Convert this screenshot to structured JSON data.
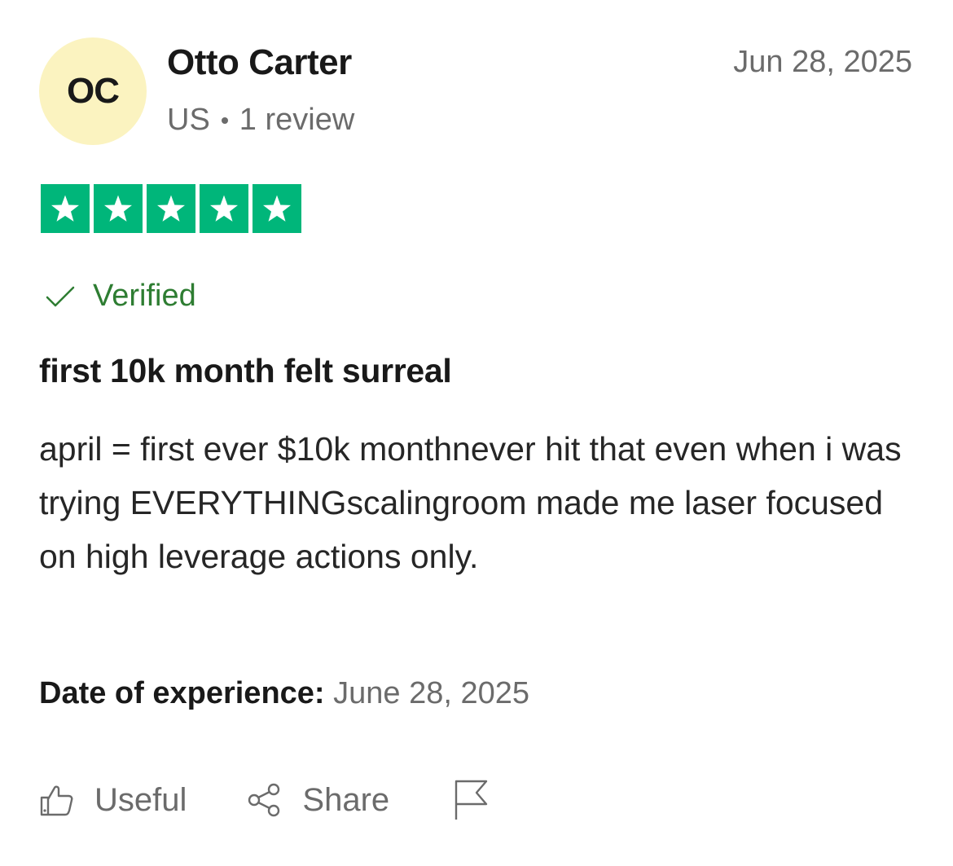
{
  "reviewer": {
    "initials": "OC",
    "name": "Otto Carter",
    "country": "US",
    "reviews": "1 review"
  },
  "review": {
    "date": "Jun 28, 2025",
    "rating": 5,
    "rating_max": 5,
    "verified_label": "Verified",
    "title": "first 10k month felt surreal",
    "body": "april = first ever $10k monthnever hit that even when i was trying EVERYTHINGscalingroom made me laser focused on high leverage actions only.",
    "experience_label": "Date of experience:",
    "experience_date": "June 28, 2025"
  },
  "actions": {
    "useful_label": "Useful",
    "share_label": "Share"
  },
  "colors": {
    "star_green": "#00b67a",
    "avatar_bg": "#fbf3c0",
    "verified_green": "#2e7d32",
    "muted_text": "#6b6b6b"
  },
  "icons": [
    "star-icon",
    "check-icon",
    "thumbs-up-icon",
    "share-icon",
    "flag-icon"
  ]
}
